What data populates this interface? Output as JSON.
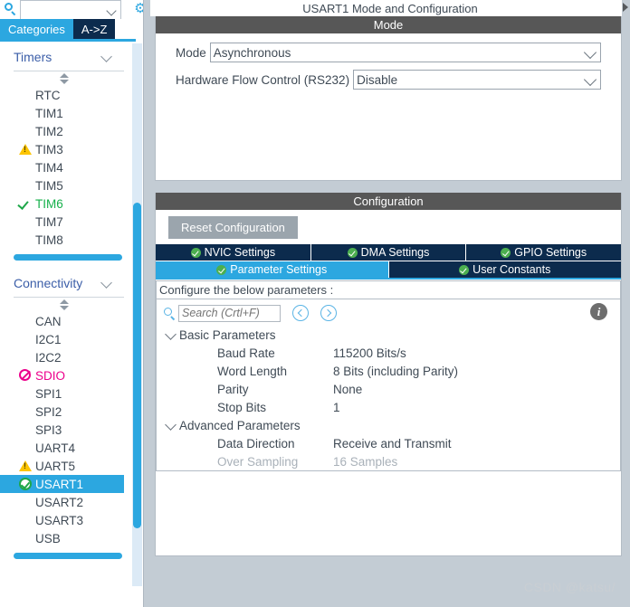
{
  "left_panel": {
    "search": {
      "value": "",
      "placeholder": ""
    },
    "gear_icon": "gear-icon",
    "tabs": [
      {
        "label": "Categories",
        "active": true
      },
      {
        "label": "A->Z",
        "active": false
      }
    ],
    "groups": [
      {
        "title": "Timers",
        "items": [
          {
            "label": "RTC",
            "status": "none"
          },
          {
            "label": "TIM1",
            "status": "none"
          },
          {
            "label": "TIM2",
            "status": "none"
          },
          {
            "label": "TIM3",
            "status": "warning"
          },
          {
            "label": "TIM4",
            "status": "none"
          },
          {
            "label": "TIM5",
            "status": "none"
          },
          {
            "label": "TIM6",
            "status": "ok"
          },
          {
            "label": "TIM7",
            "status": "none"
          },
          {
            "label": "TIM8",
            "status": "none"
          }
        ]
      },
      {
        "title": "Connectivity",
        "items": [
          {
            "label": "CAN",
            "status": "none"
          },
          {
            "label": "I2C1",
            "status": "none"
          },
          {
            "label": "I2C2",
            "status": "none"
          },
          {
            "label": "SDIO",
            "status": "blocked"
          },
          {
            "label": "SPI1",
            "status": "none"
          },
          {
            "label": "SPI2",
            "status": "none"
          },
          {
            "label": "SPI3",
            "status": "none"
          },
          {
            "label": "UART4",
            "status": "none"
          },
          {
            "label": "UART5",
            "status": "warning"
          },
          {
            "label": "USART1",
            "status": "configured",
            "selected": true
          },
          {
            "label": "USART2",
            "status": "none"
          },
          {
            "label": "USART3",
            "status": "none"
          },
          {
            "label": "USB",
            "status": "none"
          }
        ]
      }
    ]
  },
  "right_panel": {
    "title": "USART1 Mode and Configuration",
    "mode_section": {
      "header": "Mode",
      "fields": [
        {
          "label": "Mode",
          "value": "Asynchronous"
        },
        {
          "label": "Hardware Flow Control (RS232)",
          "value": "Disable"
        }
      ]
    },
    "configuration_section": {
      "header": "Configuration",
      "reset_button": "Reset Configuration",
      "tabs_row1": [
        {
          "label": "NVIC Settings",
          "active": false
        },
        {
          "label": "DMA Settings",
          "active": false
        },
        {
          "label": "GPIO Settings",
          "active": false
        }
      ],
      "tabs_row2": [
        {
          "label": "Parameter Settings",
          "active": true
        },
        {
          "label": "User Constants",
          "active": false
        }
      ],
      "hint": "Configure the below parameters :",
      "search": {
        "value": "",
        "placeholder": "Search (Crtl+F)"
      },
      "nav_prev_icon": "chevron-left-circle-icon",
      "nav_next_icon": "chevron-right-circle-icon",
      "info_icon": "info-icon",
      "parameter_groups": [
        {
          "name": "Basic Parameters",
          "expanded": true,
          "rows": [
            {
              "name": "Baud Rate",
              "value": "115200 Bits/s",
              "disabled": false
            },
            {
              "name": "Word Length",
              "value": "8 Bits (including Parity)",
              "disabled": false
            },
            {
              "name": "Parity",
              "value": "None",
              "disabled": false
            },
            {
              "name": "Stop Bits",
              "value": "1",
              "disabled": false
            }
          ]
        },
        {
          "name": "Advanced Parameters",
          "expanded": true,
          "rows": [
            {
              "name": "Data Direction",
              "value": "Receive and Transmit",
              "disabled": false
            },
            {
              "name": "Over Sampling",
              "value": "16 Samples",
              "disabled": true
            }
          ]
        }
      ]
    },
    "watermark": "CSDN @katsu/"
  },
  "colors": {
    "accent_blue": "#2ca7e0",
    "tab_navy": "#0c2b4d",
    "section_header_gray": "#575757",
    "warning_yellow": "#fdc500",
    "ok_green": "#1fa74a",
    "blocked_pink": "#ec008c"
  }
}
